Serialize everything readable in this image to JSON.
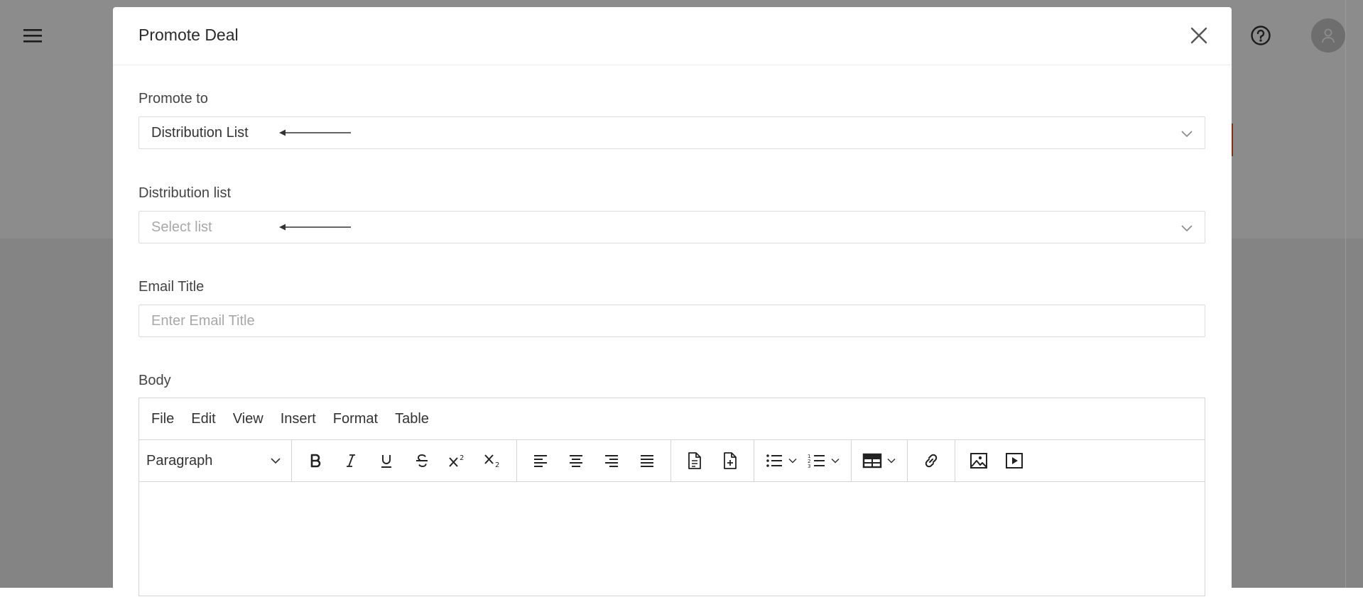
{
  "modal": {
    "title": "Promote Deal",
    "promote_to": {
      "label": "Promote to",
      "value": "Distribution List"
    },
    "distribution_list": {
      "label": "Distribution list",
      "placeholder": "Select list"
    },
    "email_title": {
      "label": "Email Title",
      "placeholder": "Enter Email Title"
    },
    "body": {
      "label": "Body",
      "menubar": [
        "File",
        "Edit",
        "View",
        "Insert",
        "Format",
        "Table"
      ],
      "block_format": "Paragraph",
      "toolbar_icons": [
        "bold-icon",
        "italic-icon",
        "underline-icon",
        "strikethrough-icon",
        "superscript-icon",
        "subscript-icon",
        "align-left-icon",
        "align-center-icon",
        "align-right-icon",
        "align-justify-icon",
        "template-icon",
        "new-document-icon",
        "bullet-list-icon",
        "numbered-list-icon",
        "table-icon",
        "link-icon",
        "image-icon",
        "media-icon"
      ]
    }
  },
  "colors": {
    "accent": "#e35b1e",
    "overlay": "rgba(0,0,0,0.45)",
    "border": "#dcdcdc"
  }
}
